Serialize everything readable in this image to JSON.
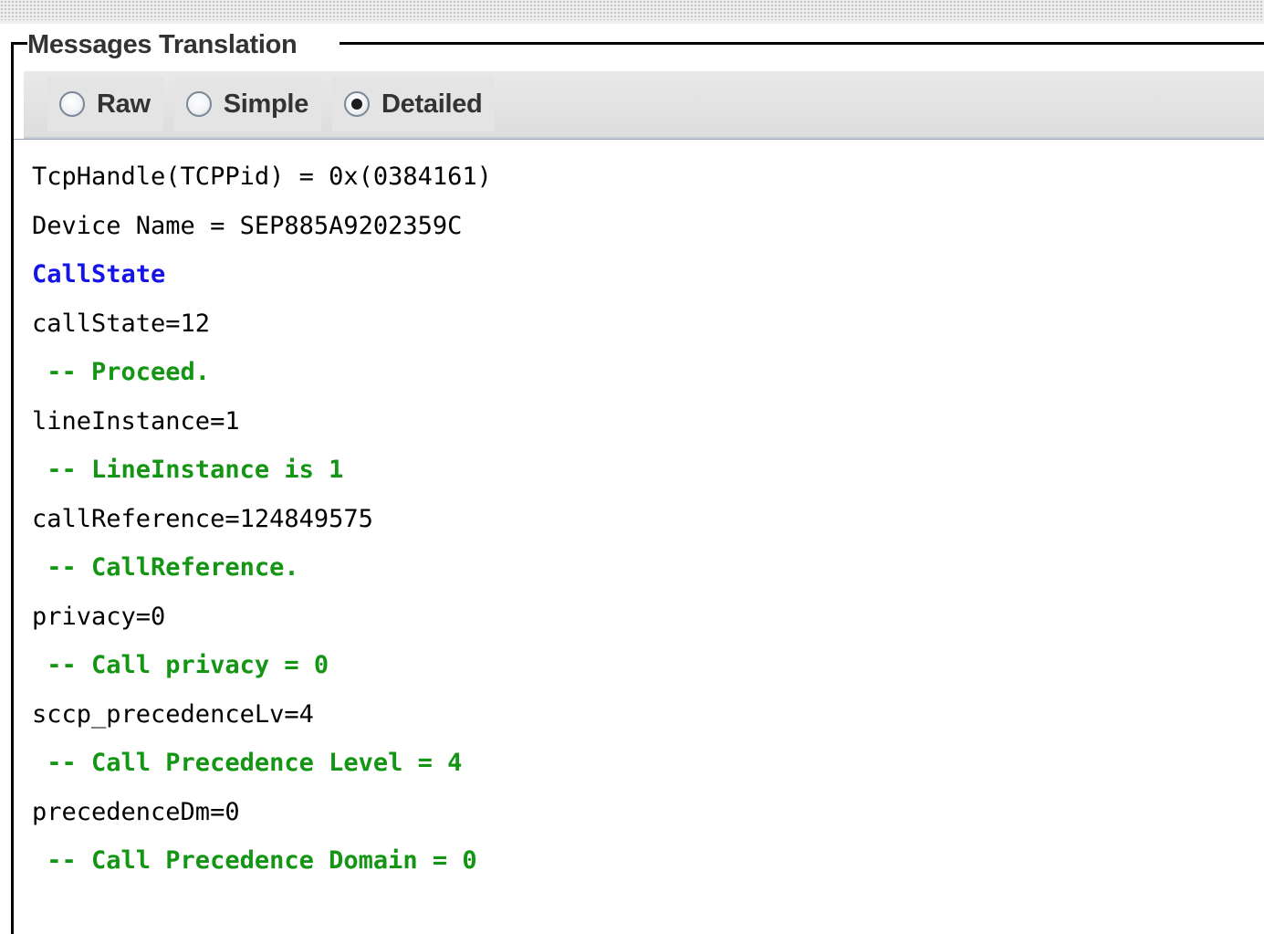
{
  "panel": {
    "title": "Messages Translation"
  },
  "view_modes": [
    {
      "label": "Raw",
      "selected": false
    },
    {
      "label": "Simple",
      "selected": false
    },
    {
      "label": "Detailed",
      "selected": true
    }
  ],
  "colors": {
    "header": "#1414e6",
    "comment": "#149614",
    "field": "#000000"
  },
  "message_lines": [
    {
      "text": "TcpHandle(TCPPid) = 0x(0384161)",
      "kind": "field"
    },
    {
      "text": "Device Name = SEP885A9202359C",
      "kind": "field"
    },
    {
      "text": "CallState",
      "kind": "header"
    },
    {
      "text": "callState=12",
      "kind": "field"
    },
    {
      "text": " -- Proceed.",
      "kind": "comment"
    },
    {
      "text": "lineInstance=1",
      "kind": "field"
    },
    {
      "text": " -- LineInstance is 1",
      "kind": "comment"
    },
    {
      "text": "callReference=124849575",
      "kind": "field"
    },
    {
      "text": " -- CallReference.",
      "kind": "comment"
    },
    {
      "text": "privacy=0",
      "kind": "field"
    },
    {
      "text": " -- Call privacy = 0",
      "kind": "comment"
    },
    {
      "text": "sccp_precedenceLv=4",
      "kind": "field"
    },
    {
      "text": " -- Call Precedence Level = 4",
      "kind": "comment"
    },
    {
      "text": "precedenceDm=0",
      "kind": "field"
    },
    {
      "text": " -- Call Precedence Domain = 0",
      "kind": "comment"
    }
  ]
}
